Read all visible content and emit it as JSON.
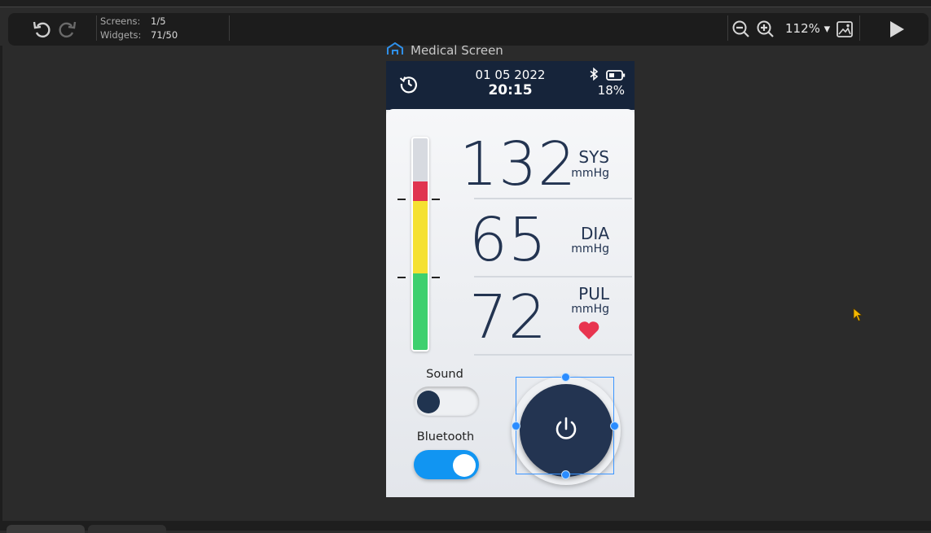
{
  "toolbar": {
    "screens_label": "Screens:",
    "screens_value": "1/5",
    "widgets_label": "Widgets:",
    "widgets_value": "71/50",
    "zoom": "112%",
    "icons": [
      "undo-icon",
      "redo-icon",
      "zoom-out-icon",
      "zoom-in-icon",
      "chevron-down-icon",
      "image-icon",
      "play-icon"
    ]
  },
  "canvas": {
    "screen_title": "Medical Screen"
  },
  "device": {
    "date": "01 05 2022",
    "time": "20:15",
    "battery": "18%",
    "readings": [
      {
        "value": "132",
        "label": "SYS",
        "unit": "mmHg"
      },
      {
        "value": "65",
        "label": "DIA",
        "unit": "mmHg"
      },
      {
        "value": "72",
        "label": "PUL",
        "unit": "mmHg"
      }
    ],
    "sound_label": "Sound",
    "sound_on": false,
    "bluetooth_label": "Bluetooth",
    "bluetooth_on": true,
    "colors": {
      "header": "#16243a",
      "text": "#233451",
      "gauge_red": "#e0344f",
      "gauge_yellow": "#f5e132",
      "gauge_green": "#3ed06e",
      "toggle_on": "#1195f2",
      "heart": "#e8344f",
      "selection": "#3b95ff"
    }
  }
}
